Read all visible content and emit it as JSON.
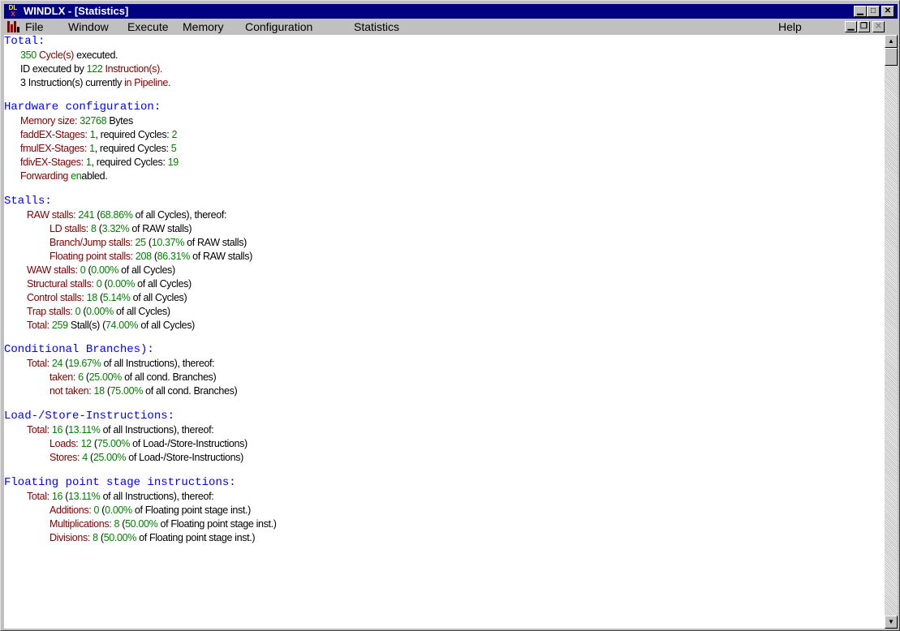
{
  "window": {
    "title": "WINDLX - [Statistics]",
    "app_icon": "windlx-app-icon"
  },
  "menubar": {
    "items": [
      "File",
      "Window",
      "Execute",
      "Memory",
      "Configuration",
      "Statistics",
      "Help"
    ]
  },
  "colors": {
    "heading": "#0000ff",
    "label": "#800000",
    "value": "#008000",
    "text": "#000000",
    "titlebar": "#000080"
  },
  "total": {
    "heading": "Total:",
    "cycles": "350",
    "cycles_label": "Cycle(s)",
    "cycles_suffix": "executed.",
    "id_prefix": "ID executed by",
    "id_value": "122",
    "id_label": "Instruction(s).",
    "pipe_value": "3",
    "pipe_text": "Instruction(s) currently",
    "pipe_label": "in Pipeline."
  },
  "hardware": {
    "heading": "Hardware configuration:",
    "memory_label": "Memory size:",
    "memory_value": "32768",
    "memory_unit": "Bytes",
    "fadd_label": "faddEX-Stages:",
    "fadd_value": "1",
    "fadd_sep": ", required Cycles:",
    "fadd_cycles": "2",
    "fmul_label": "fmulEX-Stages:",
    "fmul_value": "1",
    "fmul_sep": ", required Cycles:",
    "fmul_cycles": "5",
    "fdiv_label": "fdivEX-Stages:",
    "fdiv_value": "1",
    "fdiv_sep": ", required Cycles:",
    "fdiv_cycles": "19",
    "fwd_label": "Forwarding",
    "fwd_value": "en",
    "fwd_suffix": "abled."
  },
  "stalls": {
    "heading": "Stalls:",
    "raw_label": "RAW stalls:",
    "raw_value": "241",
    "raw_open": "(",
    "raw_pct": "68.86%",
    "raw_suffix": "of all Cycles), thereof:",
    "ld_label": "LD stalls:",
    "ld_value": "8",
    "ld_open": "(",
    "ld_pct": "3.32%",
    "ld_suffix": "of RAW stalls)",
    "bj_label": "Branch/Jump stalls:",
    "bj_value": "25",
    "bj_open": "(",
    "bj_pct": "10.37%",
    "bj_suffix": "of RAW stalls)",
    "fp_label": "Floating point stalls:",
    "fp_value": "208",
    "fp_open": "(",
    "fp_pct": "86.31%",
    "fp_suffix": "of RAW stalls)",
    "waw_label": "WAW stalls:",
    "waw_value": "0",
    "waw_open": "(",
    "waw_pct": "0.00%",
    "waw_suffix": "of all Cycles)",
    "str_label": "Structural stalls:",
    "str_value": "0",
    "str_open": "(",
    "str_pct": "0.00%",
    "str_suffix": "of all Cycles)",
    "ctl_label": "Control stalls:",
    "ctl_value": "18",
    "ctl_open": "(",
    "ctl_pct": "5.14%",
    "ctl_suffix": "of all Cycles)",
    "trap_label": "Trap stalls:",
    "trap_value": "0",
    "trap_open": "(",
    "trap_pct": "0.00%",
    "trap_suffix": "of all Cycles)",
    "tot_label": "Total:",
    "tot_value": "259",
    "tot_unit": "Stall(s)",
    "tot_open": "(",
    "tot_pct": "74.00%",
    "tot_suffix": "of all Cycles)"
  },
  "branches": {
    "heading": "Conditional Branches):",
    "tot_label": "Total:",
    "tot_value": "24",
    "tot_open": "(",
    "tot_pct": "19.67%",
    "tot_suffix": "of all Instructions), thereof:",
    "taken_label": "taken:",
    "taken_value": "6",
    "taken_open": "(",
    "taken_pct": "25.00%",
    "taken_suffix": "of all cond. Branches)",
    "nt_label": "not taken:",
    "nt_value": "18",
    "nt_open": "(",
    "nt_pct": "75.00%",
    "nt_suffix": "of all cond. Branches)"
  },
  "loadstore": {
    "heading": "Load-/Store-Instructions:",
    "tot_label": "Total:",
    "tot_value": "16",
    "tot_open": "(",
    "tot_pct": "13.11%",
    "tot_suffix": "of all Instructions), thereof:",
    "ld_label": "Loads:",
    "ld_value": "12",
    "ld_open": "(",
    "ld_pct": "75.00%",
    "ld_suffix": "of Load-/Store-Instructions)",
    "st_label": "Stores:",
    "st_value": "4",
    "st_open": "(",
    "st_pct": "25.00%",
    "st_suffix": "of Load-/Store-Instructions)"
  },
  "floating": {
    "heading": "Floating point stage instructions:",
    "tot_label": "Total:",
    "tot_value": "16",
    "tot_open": "(",
    "tot_pct": "13.11%",
    "tot_suffix": "of all Instructions), thereof:",
    "add_label": "Additions:",
    "add_value": "0",
    "add_open": "(",
    "add_pct": "0.00%",
    "add_suffix": "of Floating point stage inst.)",
    "mul_label": "Multiplications:",
    "mul_value": "8",
    "mul_open": "(",
    "mul_pct": "50.00%",
    "mul_suffix": "of Floating point stage inst.)",
    "div_label": "Divisions:",
    "div_value": "8",
    "div_open": "(",
    "div_pct": "50.00%",
    "div_suffix": "of Floating point stage inst.)"
  }
}
